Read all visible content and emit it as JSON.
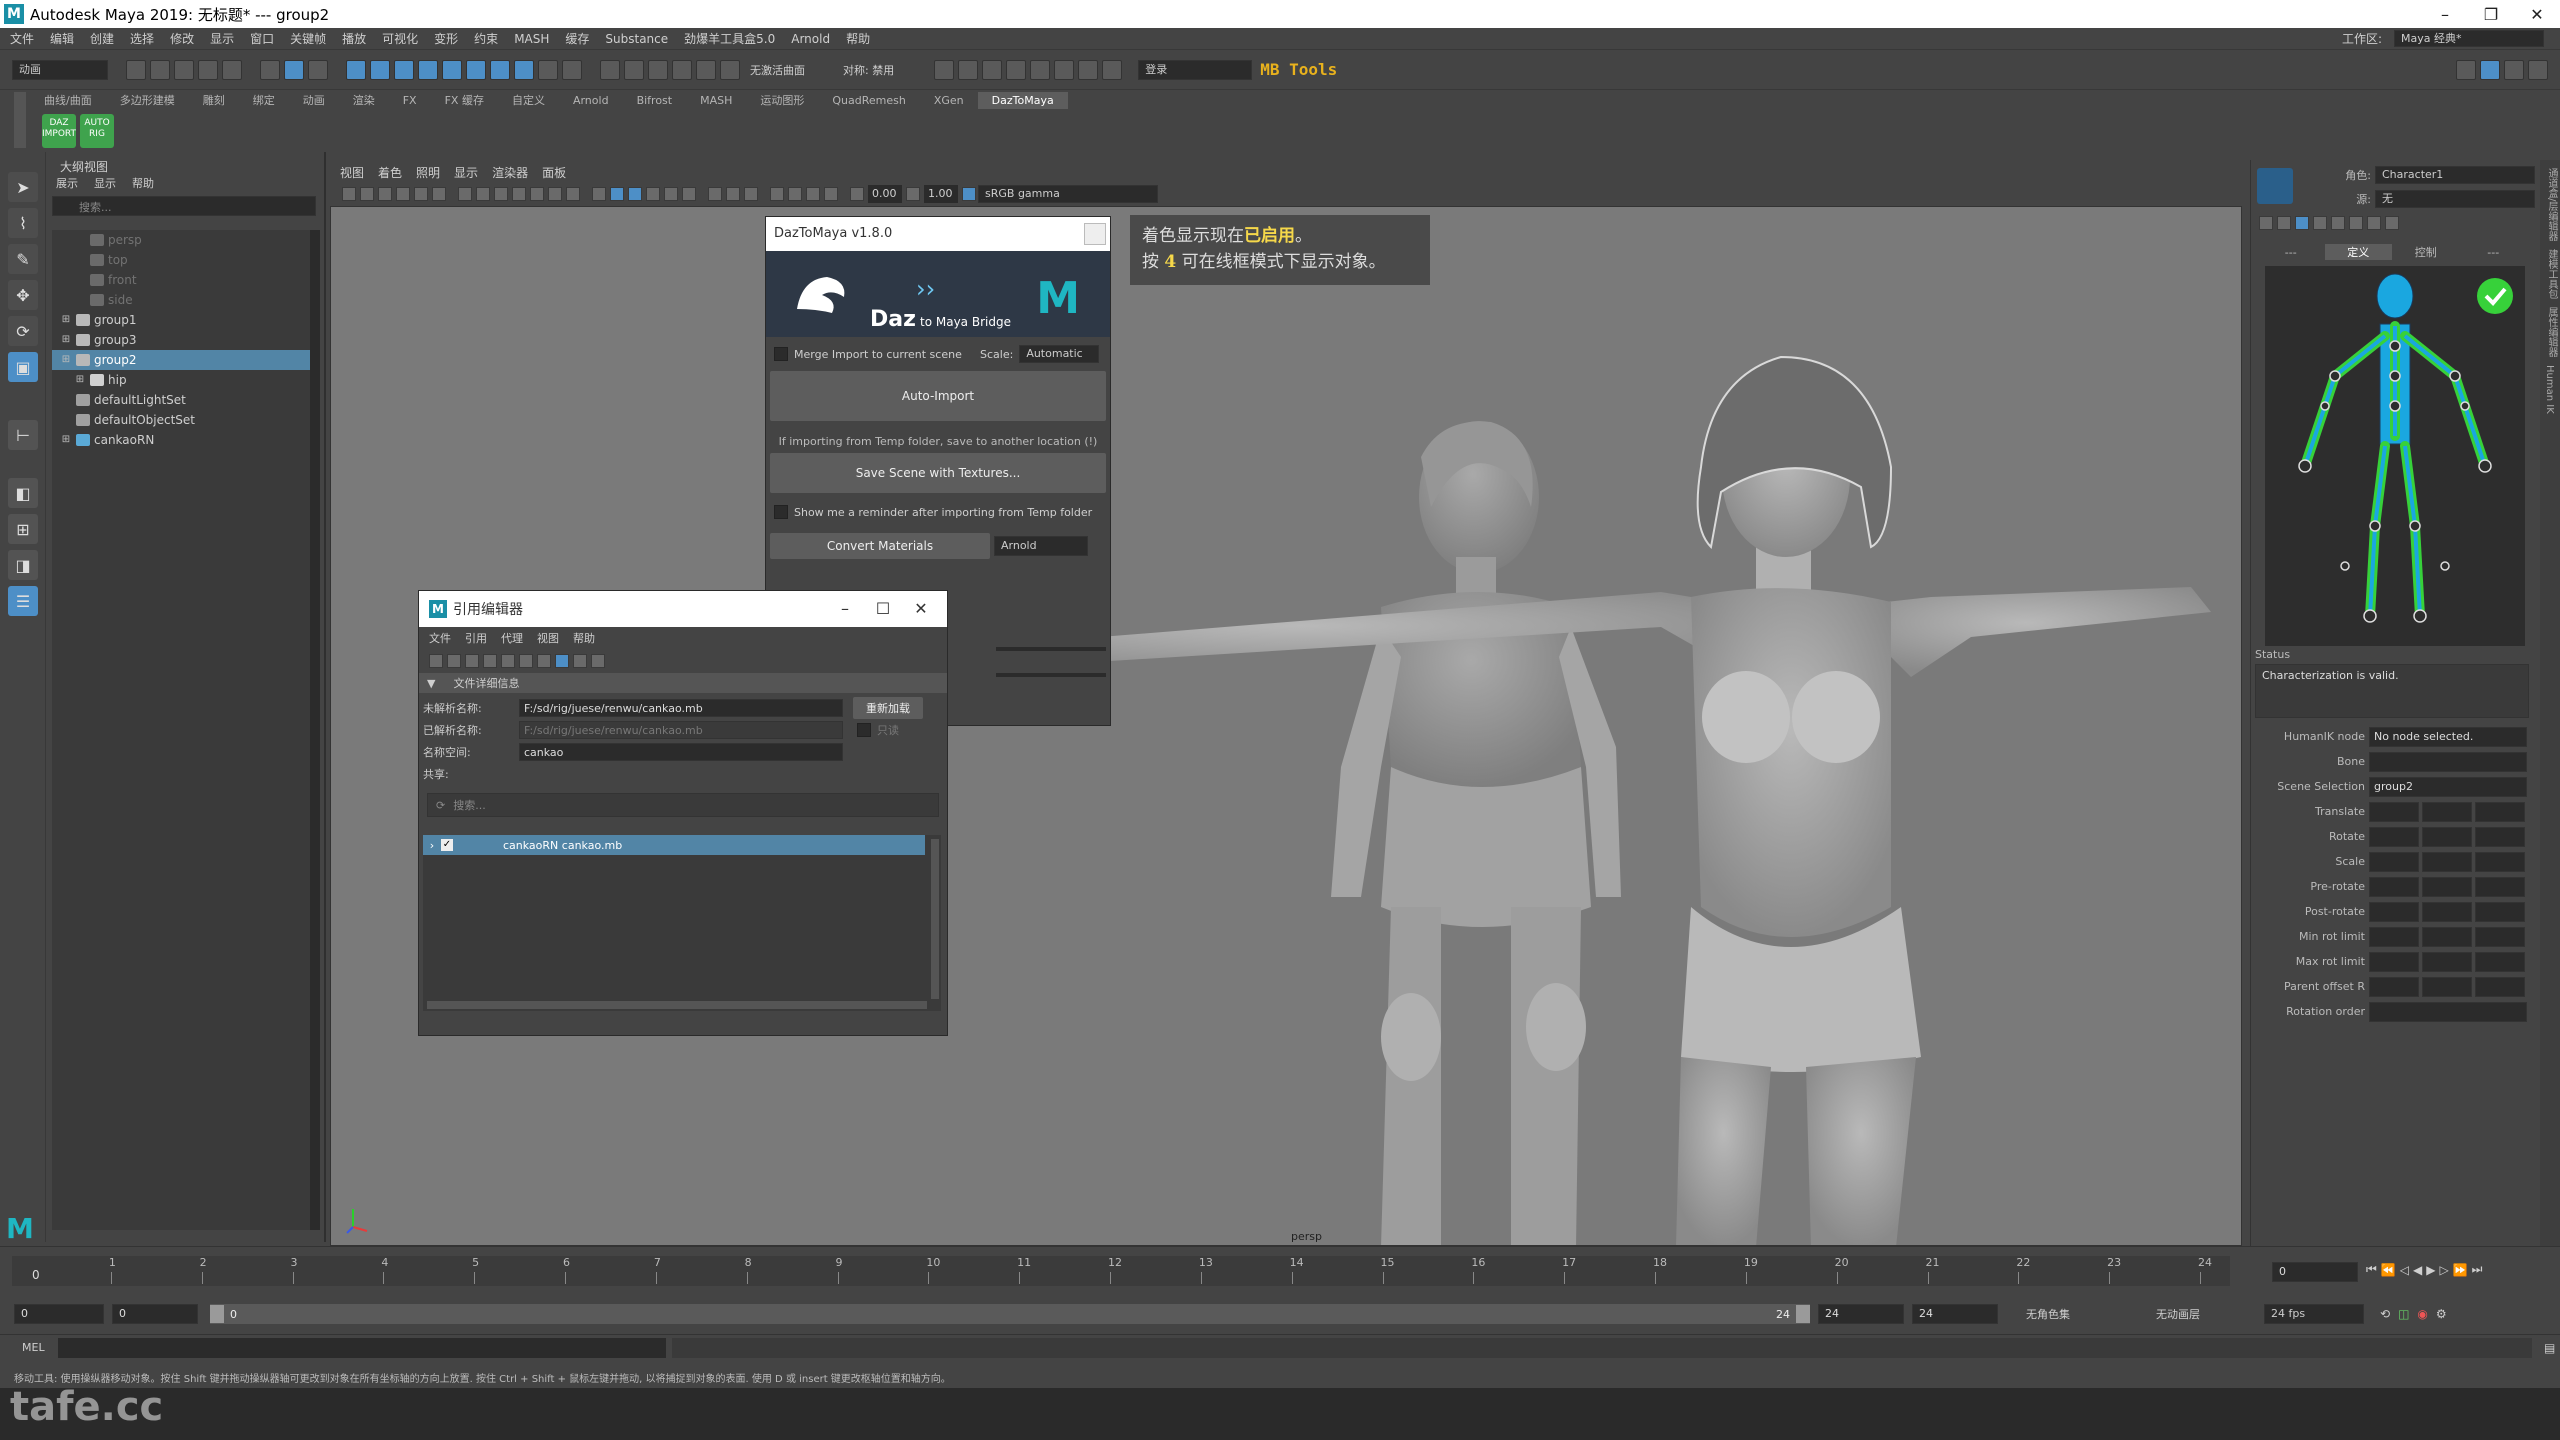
{
  "window": {
    "title": "Autodesk Maya 2019: 无标题*   ---   group2"
  },
  "menubar": {
    "items": [
      "文件",
      "编辑",
      "创建",
      "选择",
      "修改",
      "显示",
      "窗口",
      "关键帧",
      "播放",
      "可视化",
      "变形",
      "约束",
      "MASH",
      "缓存",
      "Substance",
      "劲爆羊工具盒5.0",
      "Arnold",
      "帮助"
    ],
    "workspace_label": "工作区:",
    "workspace_value": "Maya 经典*"
  },
  "statusline": {
    "mode": "动画",
    "no_live_surface": "无激活曲面",
    "symmetry": "对称: 禁用",
    "login": "登录",
    "mbtools": "MB Tools"
  },
  "shelf": {
    "tabs": [
      "曲线/曲面",
      "多边形建模",
      "雕刻",
      "绑定",
      "动画",
      "渲染",
      "FX",
      "FX 缓存",
      "自定义",
      "Arnold",
      "Bifrost",
      "MASH",
      "运动图形",
      "QuadRemesh",
      "XGen",
      "DazToMaya"
    ],
    "active_tab": "DazToMaya",
    "icons": [
      {
        "label": "DAZ IMPORT",
        "color": "#3fa34d"
      },
      {
        "label": "AUTO RIG",
        "color": "#3fa34d"
      }
    ]
  },
  "outliner": {
    "title": "大纲视图",
    "menu": [
      "展示",
      "显示",
      "帮助"
    ],
    "search_placeholder": "搜索...",
    "items": [
      {
        "label": "persp",
        "dim": true,
        "indent": 1,
        "icon": "camera"
      },
      {
        "label": "top",
        "dim": true,
        "indent": 1,
        "icon": "camera"
      },
      {
        "label": "front",
        "dim": true,
        "indent": 1,
        "icon": "camera"
      },
      {
        "label": "side",
        "dim": true,
        "indent": 1,
        "icon": "camera"
      },
      {
        "label": "group1",
        "dim": false,
        "indent": 0,
        "icon": "group"
      },
      {
        "label": "group3",
        "dim": false,
        "indent": 0,
        "icon": "group"
      },
      {
        "label": "group2",
        "dim": false,
        "indent": 0,
        "icon": "group",
        "selected": true
      },
      {
        "label": "hip",
        "dim": false,
        "indent": 1,
        "icon": "joint"
      },
      {
        "label": "defaultLightSet",
        "dim": false,
        "indent": 0,
        "icon": "set"
      },
      {
        "label": "defaultObjectSet",
        "dim": false,
        "indent": 0,
        "icon": "set"
      },
      {
        "label": "cankaoRN",
        "dim": false,
        "indent": 0,
        "icon": "reference"
      }
    ]
  },
  "viewport": {
    "menu": [
      "视图",
      "着色",
      "照明",
      "显示",
      "渲染器",
      "面板"
    ],
    "exposure": "0.00",
    "gamma": "1.00",
    "colorspace": "sRGB gamma",
    "camera_label": "persp",
    "hud_line1_prefix": "着色显示现在",
    "hud_line1_highlight": "已启用",
    "hud_line1_suffix": "。",
    "hud_line2_prefix": "按 ",
    "hud_line2_key": "4",
    "hud_line2_suffix": " 可在线框模式下显示对象。"
  },
  "daztomaya": {
    "title": "DazToMaya v1.8.0",
    "banner_text": "Daz",
    "banner_sub": "to Maya Bridge",
    "merge_label": "Merge Import to current scene",
    "scale_label": "Scale:",
    "scale_value": "Automatic",
    "auto_import": "Auto-Import",
    "temp_note": "If importing from Temp folder, save to another location (!)",
    "save_scene": "Save Scene with Textures...",
    "reminder": "Show me a reminder after importing from Temp folder",
    "convert_materials": "Convert Materials",
    "renderer": "Arnold"
  },
  "reference_editor": {
    "title": "引用编辑器",
    "menu": [
      "文件",
      "引用",
      "代理",
      "视图",
      "帮助"
    ],
    "section": "文件详细信息",
    "unresolved_label": "未解析名称:",
    "unresolved_value": "F:/sd/rig/juese/renwu/cankao.mb",
    "resolved_label": "已解析名称:",
    "resolved_value": "F:/sd/rig/juese/renwu/cankao.mb",
    "namespace_label": "名称空间:",
    "namespace_value": "cankao",
    "shared_label": "共享:",
    "reload_button": "重新加载",
    "readonly_label": "只读",
    "search_placeholder": "搜索...",
    "rows": [
      {
        "label": "cankaoRN  cankao.mb",
        "checked": true
      }
    ]
  },
  "humanik": {
    "character_label": "角色:",
    "character_value": "Character1",
    "source_label": "源:",
    "source_value": "无",
    "tabs": [
      "---",
      "定义",
      "控制",
      "---"
    ],
    "status_label": "Status",
    "status_text": "Characterization is valid.",
    "node_label": "HumanIK node",
    "node_value": "No node selected.",
    "fields": [
      "Bone",
      "Scene Selection",
      "Translate",
      "Rotate",
      "Scale",
      "Pre-rotate",
      "Post-rotate",
      "Min rot limit",
      "Max rot limit",
      "Parent offset R",
      "Rotation order"
    ],
    "scene_selection_value": "group2"
  },
  "right_strip": [
    "通道盒/层编辑器",
    "建模工具包",
    "属性编辑器",
    "Human IK"
  ],
  "timeline": {
    "ticks": [
      "1",
      "2",
      "3",
      "4",
      "5",
      "6",
      "7",
      "8",
      "9",
      "10",
      "11",
      "12",
      "13",
      "14",
      "15",
      "16",
      "17",
      "18",
      "19",
      "20",
      "21",
      "22",
      "23",
      "24"
    ],
    "current_frame": "0",
    "frame_field": "0"
  },
  "range": {
    "start": "0",
    "start2": "0",
    "range_start": "0",
    "range_end": "24",
    "end": "24",
    "end2": "24",
    "char_set": "无角色集",
    "anim_layer": "无动画层",
    "fps": "24 fps"
  },
  "command": {
    "label": "MEL"
  },
  "helpline": "移动工具: 使用操纵器移动对象。按住 Shift 键并拖动操纵器轴可更改到对象在所有坐标轴的方向上放置. 按住 Ctrl + Shift + 鼠标左键并拖动, 以将捕捉到对象的表面. 使用 D 或 insert 键更改枢轴位置和轴方向。",
  "watermark": "tafe.cc",
  "colors": {
    "selection": "#5285a6",
    "accent": "#4d8fc7",
    "mbtools": "#e9b21d",
    "hik_green": "#37d13a"
  }
}
